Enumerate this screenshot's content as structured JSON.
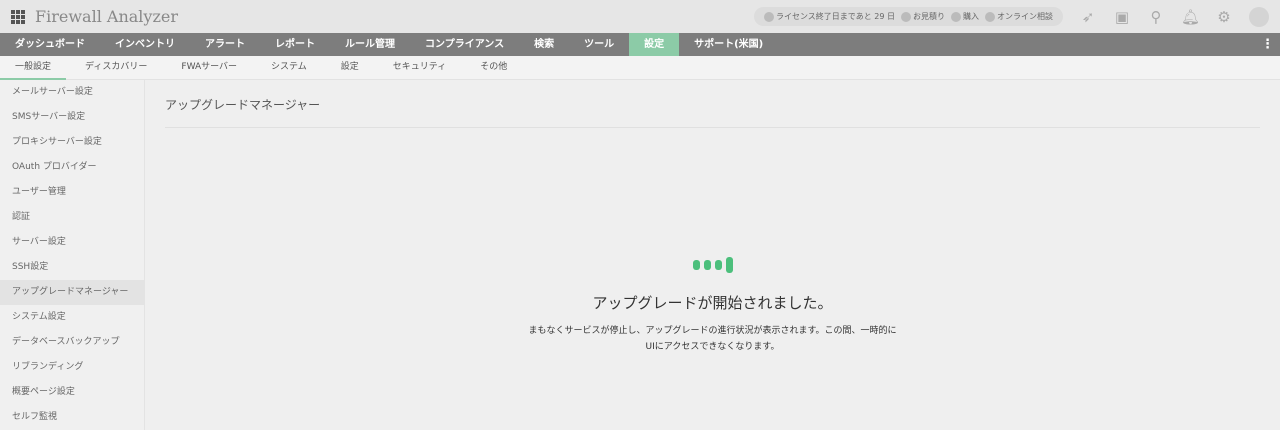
{
  "app": {
    "title": "Firewall Analyzer"
  },
  "header": {
    "license": "ライセンス終了日まであと 29 日",
    "quote": "お見積り",
    "buy": "購入",
    "consult": "オンライン相談"
  },
  "nav": [
    "ダッシュボード",
    "インベントリ",
    "アラート",
    "レポート",
    "ルール管理",
    "コンプライアンス",
    "検索",
    "ツール",
    "設定",
    "サポート(米国)"
  ],
  "subnav": [
    "一般設定",
    "ディスカバリー",
    "FWAサーバー",
    "システム",
    "設定",
    "セキュリティ",
    "その他"
  ],
  "sidebar": [
    "メールサーバー設定",
    "SMSサーバー設定",
    "プロキシサーバー設定",
    "OAuth プロバイダー",
    "ユーザー管理",
    "認証",
    "サーバー設定",
    "SSH設定",
    "アップグレードマネージャー",
    "システム設定",
    "データベースバックアップ",
    "リブランディング",
    "概要ページ設定",
    "セルフ監視"
  ],
  "main": {
    "heading": "アップグレードマネージャー",
    "message": "アップグレードが開始されました。",
    "description": "まもなくサービスが停止し、アップグレードの進行状況が表示されます。この間、一時的にUIにアクセスできなくなります。"
  },
  "colors": {
    "accent": "#8ccba7",
    "spinner": "#4cbf7c"
  }
}
